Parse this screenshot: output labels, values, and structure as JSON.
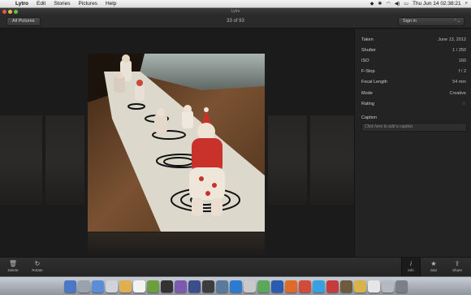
{
  "menubar": {
    "apple": "",
    "app_name": "Lytro",
    "menus": [
      "Edit",
      "Stories",
      "Pictures",
      "Help"
    ],
    "clock": "Thu Jun 14  02:38:21"
  },
  "window": {
    "title": "Lytro"
  },
  "toolbar": {
    "all_pictures_label": "All Pictures",
    "counter": "33 of 93",
    "sign_in_label": "Sign in"
  },
  "info": {
    "rows": [
      {
        "label": "Taken",
        "value": "June 13, 2012"
      },
      {
        "label": "Shutter",
        "value": "1 / 250"
      },
      {
        "label": "ISO",
        "value": "160"
      },
      {
        "label": "F-Stop",
        "value": "f / 2"
      },
      {
        "label": "Focal Length",
        "value": "54 mm"
      },
      {
        "label": "Mode",
        "value": "Creative"
      }
    ],
    "rating_label": "Rating",
    "rating_stars": 0,
    "caption_title": "Caption",
    "caption_placeholder": "Click here to add a caption."
  },
  "bottom_toolbar": {
    "delete_label": "Delete",
    "rotate_label": "Rotate",
    "info_label": "Info",
    "star_label": "Star",
    "share_label": "Share"
  },
  "colors": {
    "accent_close": "#e25a4f",
    "accent_min": "#e0b93b",
    "accent_max": "#6fbd3f"
  }
}
